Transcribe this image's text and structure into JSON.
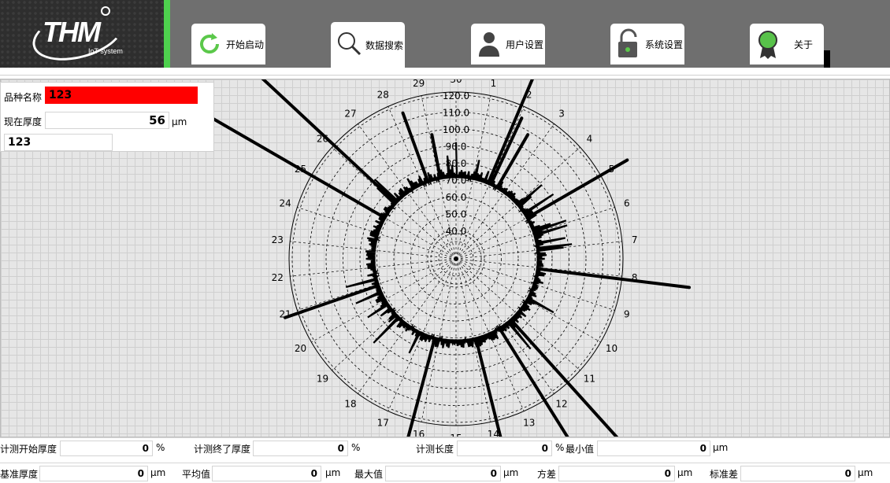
{
  "header": {
    "logo_text": "THM",
    "logo_subtext": "IoT system",
    "tabs": [
      {
        "label": "开始启动",
        "icon": "refresh-icon"
      },
      {
        "label": "数据搜索",
        "icon": "search-icon"
      },
      {
        "label": "用户设置",
        "icon": "user-icon"
      },
      {
        "label": "系统设置",
        "icon": "lock-icon"
      },
      {
        "label": "关于",
        "icon": "award-icon"
      }
    ],
    "active_tab": 1
  },
  "info": {
    "variety_label": "品种名称",
    "variety_value": "123",
    "thickness_label": "现在厚度",
    "thickness_value": "56",
    "thickness_unit": "μm",
    "extra_value": "123"
  },
  "chart_data": {
    "type": "polar",
    "angle_labels": [
      "1",
      "2",
      "3",
      "4",
      "5",
      "6",
      "7",
      "8",
      "9",
      "10",
      "11",
      "12",
      "13",
      "14",
      "15",
      "16",
      "17",
      "18",
      "19",
      "20",
      "21",
      "22",
      "23",
      "24",
      "25",
      "26",
      "27",
      "28",
      "29",
      "30"
    ],
    "radial_labels": [
      "40.0",
      "50.0",
      "60.0",
      "70.0",
      "80.0",
      "90.0",
      "100.0",
      "110.0",
      "120.0"
    ],
    "radial_range": [
      40,
      120
    ],
    "baseline_value": 72,
    "spikes": [
      {
        "angle_deg": 23,
        "value": 205
      },
      {
        "angle_deg": 25,
        "value": 115
      },
      {
        "angle_deg": 30,
        "value": 108
      },
      {
        "angle_deg": 60,
        "value": 140
      },
      {
        "angle_deg": 97,
        "value": 162
      },
      {
        "angle_deg": 138,
        "value": 220
      },
      {
        "angle_deg": 148,
        "value": 175
      },
      {
        "angle_deg": 166,
        "value": 158
      },
      {
        "angle_deg": 195,
        "value": 160
      },
      {
        "angle_deg": 251,
        "value": 130
      },
      {
        "angle_deg": 300,
        "value": 200
      },
      {
        "angle_deg": 313,
        "value": 208
      },
      {
        "angle_deg": 340,
        "value": 115
      },
      {
        "angle_deg": 349,
        "value": 98
      }
    ]
  },
  "stats_row1": [
    {
      "label": "计测开始厚度",
      "value": "0",
      "unit": "%"
    },
    {
      "label": "计测终了厚度",
      "value": "0",
      "unit": "%"
    },
    {
      "label": "计测长度",
      "value": "0",
      "unit": "%"
    },
    {
      "label": "最小值",
      "value": "0",
      "unit": "μm"
    }
  ],
  "stats_row2": [
    {
      "label": "基准厚度",
      "value": "0",
      "unit": "μm"
    },
    {
      "label": "平均值",
      "value": "0",
      "unit": "μm"
    },
    {
      "label": "最大值",
      "value": "0",
      "unit": "μm"
    },
    {
      "label": "方差",
      "value": "0",
      "unit": "μm"
    },
    {
      "label": "标准差",
      "value": "0",
      "unit": "μm"
    }
  ],
  "colors": {
    "accent": "#4ed14e",
    "highlight": "#ff0000",
    "header": "#6f6f6f"
  }
}
